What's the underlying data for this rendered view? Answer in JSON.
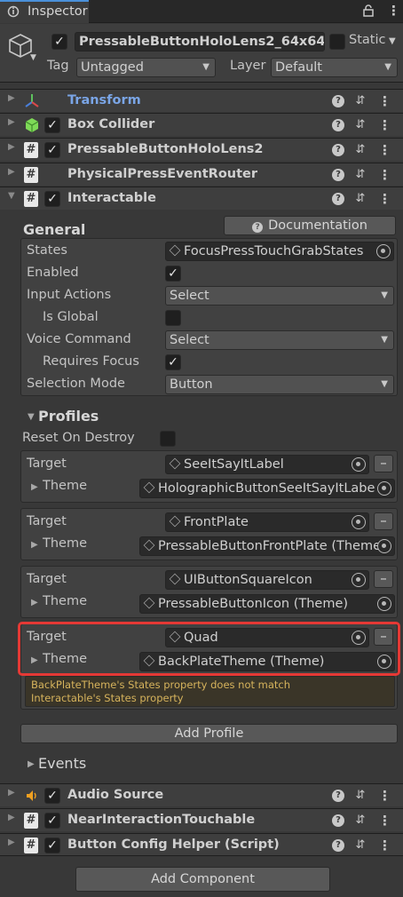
{
  "tab": {
    "title": "Inspector"
  },
  "header": {
    "object_name": "PressableButtonHoloLens2_64x64(C",
    "static_label": "Static",
    "tag_label": "Tag",
    "tag_value": "Untagged",
    "layer_label": "Layer",
    "layer_value": "Default"
  },
  "components_top": [
    {
      "label": "Transform"
    },
    {
      "label": "Box Collider"
    },
    {
      "label": "PressableButtonHoloLens2"
    },
    {
      "label": "PhysicalPressEventRouter"
    },
    {
      "label": "Interactable"
    }
  ],
  "interactable": {
    "general_heading": "General",
    "documentation_label": "Documentation",
    "states_label": "States",
    "states_value": "FocusPressTouchGrabStates",
    "enabled_label": "Enabled",
    "input_actions_label": "Input Actions",
    "input_actions_value": "Select",
    "is_global_label": "Is Global",
    "voice_command_label": "Voice Command",
    "voice_command_value": "Select",
    "requires_focus_label": "Requires Focus",
    "selection_mode_label": "Selection Mode",
    "selection_mode_value": "Button",
    "profiles_heading": "Profiles",
    "reset_on_destroy_label": "Reset On Destroy",
    "profiles": [
      {
        "target_label": "Target",
        "target_value": "SeeItSayItLabel",
        "theme_label": "Theme",
        "theme_value": "HolographicButtonSeeItSayItLabe"
      },
      {
        "target_label": "Target",
        "target_value": "FrontPlate",
        "theme_label": "Theme",
        "theme_value": "PressableButtonFrontPlate (Theme"
      },
      {
        "target_label": "Target",
        "target_value": "UIButtonSquareIcon",
        "theme_label": "Theme",
        "theme_value": "PressableButtonIcon (Theme)"
      },
      {
        "target_label": "Target",
        "target_value": "Quad",
        "theme_label": "Theme",
        "theme_value": "BackPlateTheme (Theme)"
      }
    ],
    "warning_text_1": "BackPlateTheme's States property does not match",
    "warning_text_2": "Interactable's States property",
    "add_profile_label": "Add Profile",
    "events_label": "Events"
  },
  "components_bottom": [
    {
      "label": "Audio Source"
    },
    {
      "label": "NearInteractionTouchable"
    },
    {
      "label": "Button Config Helper (Script)"
    }
  ],
  "add_component_label": "Add Component",
  "colors": {
    "highlight": "#e53935",
    "transform_label": "#7aa5e6",
    "warning": "#d6b35c"
  },
  "icons": {
    "lock": "lock-icon",
    "menu": "kebab-menu-icon",
    "gameobject": "cube-icon",
    "transform": "transform-axes-icon",
    "box_collider": "green-cube-icon",
    "script": "hash-script-icon",
    "audio": "speaker-icon",
    "help": "help-icon",
    "presets": "sliders-icon"
  }
}
